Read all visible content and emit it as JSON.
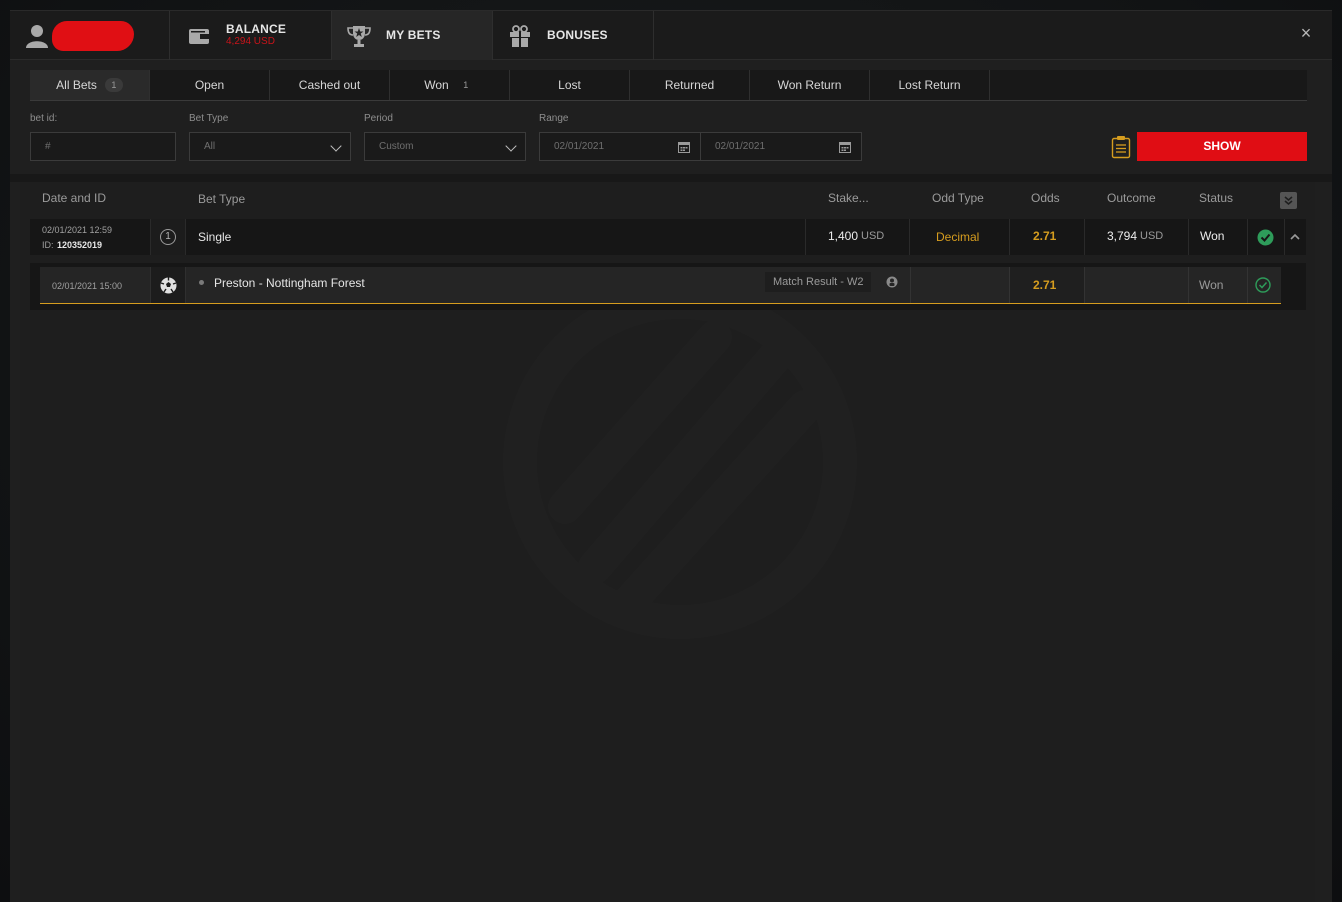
{
  "header": {
    "balance_label": "BALANCE",
    "balance_value": "4,294 USD",
    "my_bets_label": "MY BETS",
    "bonuses_label": "BONUSES",
    "close_glyph": "×"
  },
  "filter_tabs": [
    {
      "label": "All Bets",
      "count": "1"
    },
    {
      "label": "Open"
    },
    {
      "label": "Cashed out"
    },
    {
      "label": "Won",
      "count": "1"
    },
    {
      "label": "Lost"
    },
    {
      "label": "Returned"
    },
    {
      "label": "Won Return"
    },
    {
      "label": "Lost Return"
    }
  ],
  "form": {
    "bet_id_label": "bet id:",
    "bet_id_placeholder": "#",
    "bet_type_label": "Bet Type",
    "bet_type_value": "All",
    "period_label": "Period",
    "period_value": "Custom",
    "range_label": "Range",
    "range_from": "02/01/2021",
    "range_to": "02/01/2021",
    "show_label": "SHOW"
  },
  "table": {
    "headers": {
      "date_id": "Date and ID",
      "bet_type": "Bet Type",
      "stake": "Stake...",
      "odd_type": "Odd Type",
      "odds": "Odds",
      "outcome": "Outcome",
      "status": "Status"
    },
    "bet": {
      "datetime": "02/01/2021 12:59",
      "id_prefix": "ID:",
      "id": "120352019",
      "count": "1",
      "type": "Single",
      "stake_amount": "1,400",
      "stake_currency": "USD",
      "odd_type": "Decimal",
      "odds": "2.71",
      "outcome_amount": "3,794",
      "outcome_currency": "USD",
      "status": "Won"
    },
    "selection": {
      "datetime": "02/01/2021 15:00",
      "event": "Preston - Nottingham Forest",
      "market": "Match Result - W2",
      "odds": "2.71",
      "status": "Won"
    }
  },
  "colors": {
    "accent_red": "#e00d14",
    "odds_gold": "#d69d1f",
    "won_green": "#2e9c5a"
  }
}
